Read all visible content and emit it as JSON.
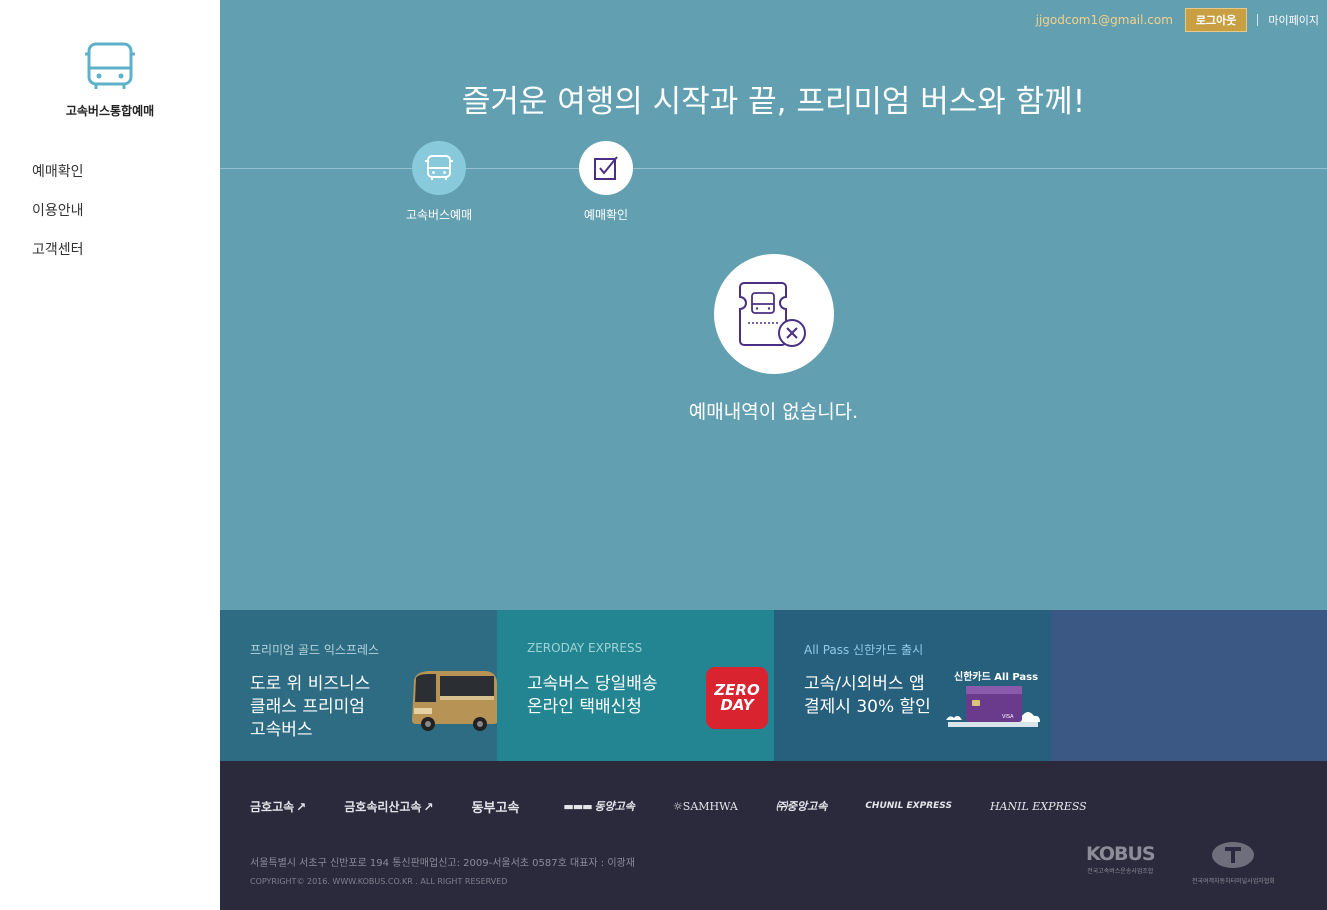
{
  "sidebar": {
    "brand_title": "고속버스통합예매",
    "menu": [
      "예매확인",
      "이용안내",
      "고객센터"
    ]
  },
  "header": {
    "email": "jjgodcom1@gmail.com",
    "logout": "로그아웃",
    "mypage": "마이페이지"
  },
  "main": {
    "headline": "즐거운 여행의 시작과 끝, 프리미엄 버스와 함께!",
    "steps": [
      {
        "label": "고속버스예매",
        "icon": "bus-icon"
      },
      {
        "label": "예매확인",
        "icon": "checkbox-icon"
      }
    ],
    "empty_message": "예매내역이 없습니다."
  },
  "promos": [
    {
      "subtitle": "프리미엄 골드 익스프레스",
      "title": "도로 위 비즈니스 클래스 프리미엄 고속버스",
      "image": "gold-bus"
    },
    {
      "subtitle": "ZERODAY EXPRESS",
      "title": "고속버스 당일배송 온라인 택배신청",
      "image": "zeroday-logo",
      "logo_text": "ZERO DAY"
    },
    {
      "subtitle": "All Pass 신한카드 출시",
      "title": "고속/시외버스 앱 결제시 30% 할인",
      "image": "shinhan-card",
      "card_caption": "신한카드 All Pass"
    }
  ],
  "footer": {
    "partners": [
      "금호고속",
      "금호속리산고속",
      "동부고속",
      "동양고속",
      "SAMHWA",
      "㈜중앙고속",
      "CHUNIL EXPRESS",
      "HANIL EXPRESS"
    ],
    "address": "서울특별시 서초구 신반포로 194 통신판매업신고: 2009-서울서초 0587호 대표자 : 이광재",
    "copyright": "COPYRIGHT© 2016. WWW.KOBUS.CO.KR . ALL RIGHT RESERVED",
    "kobus_name": "KOBUS",
    "kobus_sub": "전국고속버스운송사업조합",
    "assoc_name": "전국여객자동차터미널사업자협회"
  },
  "colors": {
    "main_bg": "#629fb1",
    "logout_btn": "#c8a043",
    "email_text": "#f2d28a",
    "footer_bg": "#2b2a3c",
    "icon_purple": "#4b2f82"
  }
}
